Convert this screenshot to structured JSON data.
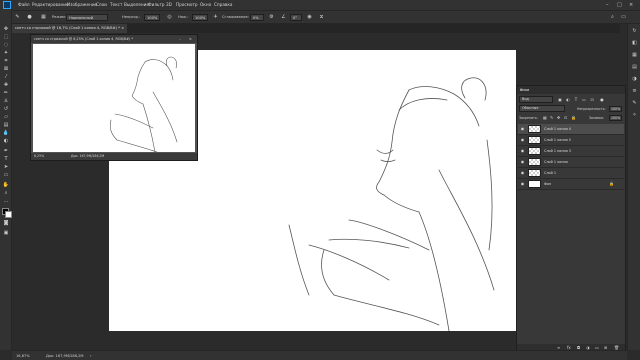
{
  "menubar": {
    "items": [
      "Файл",
      "Редактирование",
      "Изображение",
      "Слои",
      "Текст",
      "Выделение",
      "Фильтр",
      "3D",
      "Просмотр",
      "Окно",
      "Справка"
    ],
    "window_buttons": [
      "–",
      "□",
      "×"
    ]
  },
  "options": {
    "mode_label": "Режим:",
    "mode_value": "Нормальный",
    "opacity_label": "Непрозр.:",
    "opacity_value": "100%",
    "pressure_label": "Наж.:",
    "pressure_value": "100%",
    "smoothing_label": "Сглаживание:",
    "smoothing_value": "0%",
    "angle_value": "0°"
  },
  "document": {
    "tab_title": "скетч со стрижкой @ 16,7% (Слой 1 копия 4, RGB/8#) * ×",
    "zoom": "16,67%",
    "doc_info": "Док: 167,9M/286,2M"
  },
  "navigator": {
    "title": "скетч со стрижкой @ 6,25% (Слой 1 копия 4, RGB/8#) *",
    "zoom": "6,25%",
    "doc_info": "Док: 167,9M/286,2M"
  },
  "layers_panel": {
    "title": "Слои",
    "filter_placeholder": "Вид",
    "blend_mode": "Обычные",
    "opacity_label": "Непрозрачность:",
    "opacity_value": "100%",
    "lock_label": "Закрепить:",
    "fill_label": "Заливка:",
    "fill_value": "100%",
    "layers": [
      {
        "name": "Слой 1 копия 4",
        "active": true
      },
      {
        "name": "Слой 1 копия 5",
        "active": false
      },
      {
        "name": "Слой 1 копия 3",
        "active": false
      },
      {
        "name": "Слой 1 копия",
        "active": false
      },
      {
        "name": "Слой 1",
        "active": false
      },
      {
        "name": "Фон",
        "active": false,
        "locked": true
      }
    ]
  }
}
